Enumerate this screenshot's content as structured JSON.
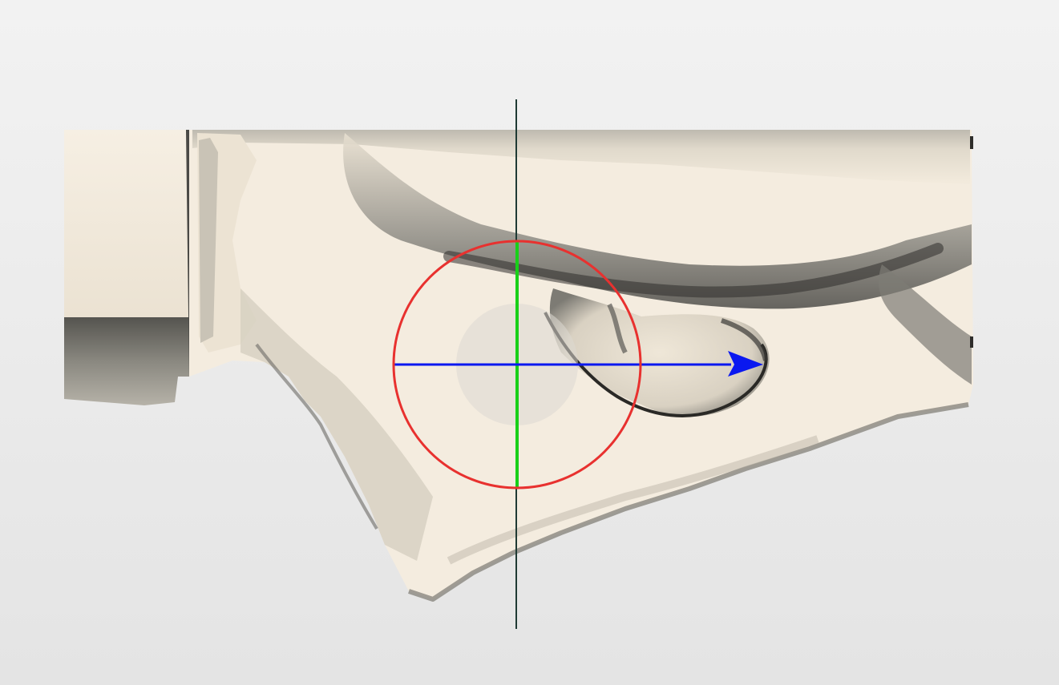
{
  "viewport": {
    "background_top": "#f2f2f2",
    "background_bottom": "#e4e4e4"
  },
  "model": {
    "surface_color": "#f4ecdf",
    "shadow_color": "#6b6a64",
    "edge_color": "#2e2d2a"
  },
  "gizmo": {
    "ring_color": "#e8312f",
    "vertical_axis_color": "#18d018",
    "horizontal_axis_color": "#0a18f0",
    "crosshair_color": "#1f3a34",
    "center_disc_color": "#dcd8d2",
    "arrow_icon": "arrow-right-icon"
  }
}
